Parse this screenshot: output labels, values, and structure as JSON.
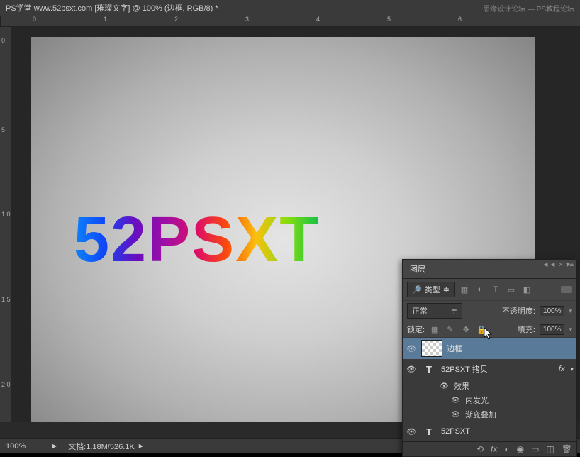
{
  "title": "PS学堂  www.52psxt.com [璀璨文字] @ 100% (边框, RGB/8) *",
  "watermark_left": "思缘设计论坛",
  "watermark_right": "PS教程论坛",
  "canvas_text": "52PSXT",
  "status": {
    "zoom": "100%",
    "doc_label": "文档:",
    "doc_info": "1.18M/526.1K"
  },
  "ruler_top": [
    "0",
    "1",
    "2",
    "3",
    "4",
    "5",
    "6"
  ],
  "ruler_left": [
    "0",
    "5",
    "1 0",
    "1 5",
    "2 0"
  ],
  "layers_panel": {
    "tab": "图层",
    "filter_label": "类型",
    "blend_mode": "正常",
    "opacity_label": "不透明度:",
    "opacity_value": "100%",
    "lock_label": "锁定:",
    "fill_label": "填充:",
    "fill_value": "100%",
    "layers": [
      {
        "name": "边框",
        "selected": true,
        "thumb": true,
        "visible": true
      },
      {
        "name": "52PSXT 拷贝",
        "type": "T",
        "fx": true,
        "visible": true,
        "effects_label": "效果",
        "effects": [
          "内发光",
          "渐变叠加"
        ]
      },
      {
        "name": "52PSXT",
        "type": "T",
        "visible": true
      }
    ]
  }
}
